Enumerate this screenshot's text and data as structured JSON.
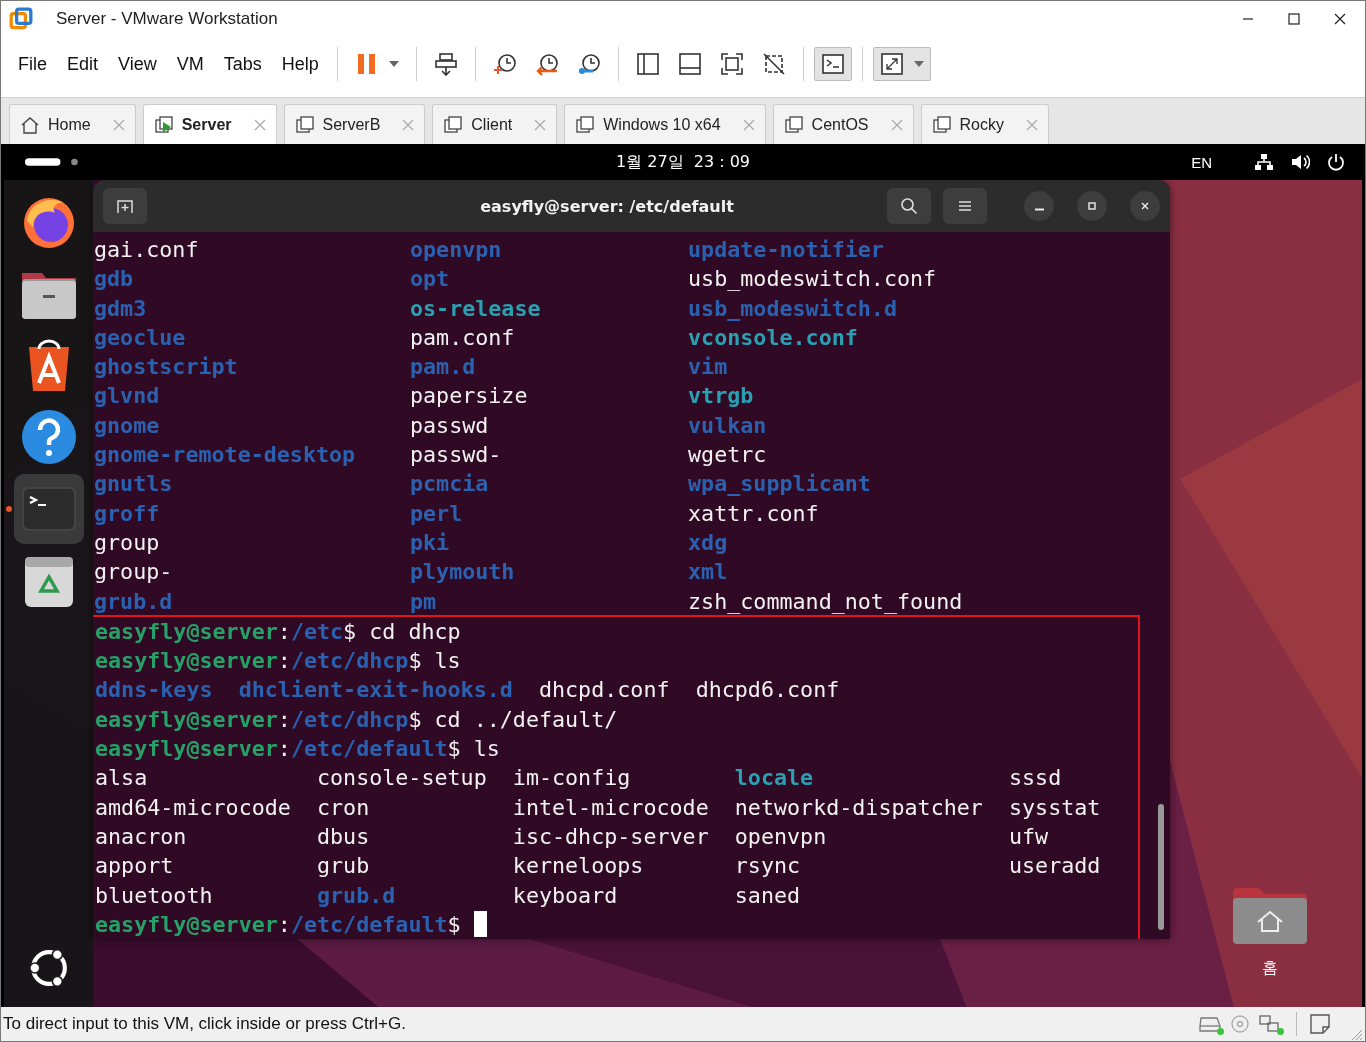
{
  "window": {
    "title": "Server - VMware Workstation"
  },
  "menu": [
    "File",
    "Edit",
    "View",
    "VM",
    "Tabs",
    "Help"
  ],
  "toolbar": [
    [
      {
        "kind": "pause",
        "pressed": false,
        "has_menu": true
      }
    ],
    [
      {
        "kind": "send-keys",
        "pressed": false,
        "has_menu": false
      }
    ],
    [
      {
        "kind": "snapshot-take",
        "pressed": false,
        "has_menu": false
      },
      {
        "kind": "snapshot-revert",
        "pressed": false,
        "has_menu": false
      },
      {
        "kind": "snapshot-manager",
        "pressed": false,
        "has_menu": false
      }
    ],
    [
      {
        "kind": "view-library",
        "pressed": false,
        "has_menu": false
      },
      {
        "kind": "view-thumbnail",
        "pressed": false,
        "has_menu": false
      },
      {
        "kind": "view-fullscreen",
        "pressed": false,
        "has_menu": false
      },
      {
        "kind": "view-unity",
        "pressed": false,
        "has_menu": false
      }
    ],
    [
      {
        "kind": "console",
        "pressed": true,
        "has_menu": false
      }
    ],
    [
      {
        "kind": "stretch",
        "pressed": true,
        "has_menu": true
      }
    ]
  ],
  "tabs": [
    {
      "label": "Home",
      "kind": "home",
      "selected": false
    },
    {
      "label": "Server",
      "kind": "vm",
      "selected": true,
      "running": true
    },
    {
      "label": "ServerB",
      "kind": "vm",
      "selected": false,
      "running": false
    },
    {
      "label": "Client",
      "kind": "vm",
      "selected": false,
      "running": false
    },
    {
      "label": "Windows 10 x64",
      "kind": "vm",
      "selected": false,
      "running": false
    },
    {
      "label": "CentOS",
      "kind": "vm",
      "selected": false,
      "running": false
    },
    {
      "label": "Rocky",
      "kind": "vm",
      "selected": false,
      "running": false
    }
  ],
  "guest": {
    "top_bar": {
      "clock": "1월 27일  23 : 09",
      "input_source": "EN"
    },
    "dock": [
      {
        "kind": "firefox",
        "active": false
      },
      {
        "kind": "files",
        "active": false
      },
      {
        "kind": "app-center",
        "active": false
      },
      {
        "kind": "help",
        "active": false
      },
      {
        "kind": "terminal",
        "active": true
      },
      {
        "kind": "trash",
        "active": false
      }
    ],
    "terminal": {
      "title": "easyfly@server: /etc/default",
      "output_above": [
        {
          "kind": "listing",
          "rows": [
            [
              {
                "text": "gai.conf",
                "kind": "file"
              },
              {
                "text": "openvpn",
                "kind": "dir"
              },
              {
                "text": "update-notifier",
                "kind": "dir"
              }
            ],
            [
              {
                "text": "gdb",
                "kind": "dir"
              },
              {
                "text": "opt",
                "kind": "dir"
              },
              {
                "text": "usb_modeswitch.conf",
                "kind": "file"
              }
            ],
            [
              {
                "text": "gdm3",
                "kind": "dir"
              },
              {
                "text": "os-release",
                "kind": "link"
              },
              {
                "text": "usb_modeswitch.d",
                "kind": "dir"
              }
            ],
            [
              {
                "text": "geoclue",
                "kind": "dir"
              },
              {
                "text": "pam.conf",
                "kind": "file"
              },
              {
                "text": "vconsole.conf",
                "kind": "link"
              }
            ],
            [
              {
                "text": "ghostscript",
                "kind": "dir"
              },
              {
                "text": "pam.d",
                "kind": "dir"
              },
              {
                "text": "vim",
                "kind": "dir"
              }
            ],
            [
              {
                "text": "glvnd",
                "kind": "dir"
              },
              {
                "text": "papersize",
                "kind": "file"
              },
              {
                "text": "vtrgb",
                "kind": "link"
              }
            ],
            [
              {
                "text": "gnome",
                "kind": "dir"
              },
              {
                "text": "passwd",
                "kind": "file"
              },
              {
                "text": "vulkan",
                "kind": "dir"
              }
            ],
            [
              {
                "text": "gnome-remote-desktop",
                "kind": "dir"
              },
              {
                "text": "passwd-",
                "kind": "file"
              },
              {
                "text": "wgetrc",
                "kind": "file"
              }
            ],
            [
              {
                "text": "gnutls",
                "kind": "dir"
              },
              {
                "text": "pcmcia",
                "kind": "dir"
              },
              {
                "text": "wpa_supplicant",
                "kind": "dir"
              }
            ],
            [
              {
                "text": "groff",
                "kind": "dir"
              },
              {
                "text": "perl",
                "kind": "dir"
              },
              {
                "text": "xattr.conf",
                "kind": "file"
              }
            ],
            [
              {
                "text": "group",
                "kind": "file"
              },
              {
                "text": "pki",
                "kind": "dir"
              },
              {
                "text": "xdg",
                "kind": "dir"
              }
            ],
            [
              {
                "text": "group-",
                "kind": "file"
              },
              {
                "text": "plymouth",
                "kind": "dir"
              },
              {
                "text": "xml",
                "kind": "dir"
              }
            ],
            [
              {
                "text": "grub.d",
                "kind": "dir"
              },
              {
                "text": "pm",
                "kind": "dir"
              },
              {
                "text": "zsh_command_not_found",
                "kind": "file"
              }
            ]
          ]
        }
      ],
      "highlighted_output": [
        {
          "kind": "prompt",
          "cursor": false,
          "segments": [
            {
              "text": "easyfly@server",
              "kind": "user"
            },
            {
              "text": ":",
              "kind": "file"
            },
            {
              "text": "/etc",
              "kind": "dir"
            },
            {
              "text": "$ cd dhcp",
              "kind": "file"
            }
          ]
        },
        {
          "kind": "prompt",
          "cursor": false,
          "segments": [
            {
              "text": "easyfly@server",
              "kind": "user"
            },
            {
              "text": ":",
              "kind": "file"
            },
            {
              "text": "/etc/dhcp",
              "kind": "dir"
            },
            {
              "text": "$ ls",
              "kind": "file"
            }
          ]
        },
        {
          "kind": "listing",
          "rows": [
            [
              {
                "text": "ddns-keys",
                "kind": "dir"
              },
              {
                "text": "dhclient-exit-hooks.d",
                "kind": "dir"
              },
              {
                "text": "dhcpd.conf",
                "kind": "file"
              },
              {
                "text": "dhcpd6.conf",
                "kind": "file"
              }
            ]
          ]
        },
        {
          "kind": "prompt",
          "cursor": false,
          "segments": [
            {
              "text": "easyfly@server",
              "kind": "user"
            },
            {
              "text": ":",
              "kind": "file"
            },
            {
              "text": "/etc/dhcp",
              "kind": "dir"
            },
            {
              "text": "$ cd ../default/",
              "kind": "file"
            }
          ]
        },
        {
          "kind": "prompt",
          "cursor": false,
          "segments": [
            {
              "text": "easyfly@server",
              "kind": "user"
            },
            {
              "text": ":",
              "kind": "file"
            },
            {
              "text": "/etc/default",
              "kind": "dir"
            },
            {
              "text": "$ ls",
              "kind": "file"
            }
          ]
        },
        {
          "kind": "listing",
          "rows": [
            [
              {
                "text": "alsa",
                "kind": "file"
              },
              {
                "text": "console-setup",
                "kind": "file"
              },
              {
                "text": "im-config",
                "kind": "file"
              },
              {
                "text": "locale",
                "kind": "link"
              },
              {
                "text": "sssd",
                "kind": "file"
              }
            ],
            [
              {
                "text": "amd64-microcode",
                "kind": "file"
              },
              {
                "text": "cron",
                "kind": "file"
              },
              {
                "text": "intel-microcode",
                "kind": "file"
              },
              {
                "text": "networkd-dispatcher",
                "kind": "file"
              },
              {
                "text": "sysstat",
                "kind": "file"
              }
            ],
            [
              {
                "text": "anacron",
                "kind": "file"
              },
              {
                "text": "dbus",
                "kind": "file"
              },
              {
                "text": "isc-dhcp-server",
                "kind": "file"
              },
              {
                "text": "openvpn",
                "kind": "file"
              },
              {
                "text": "ufw",
                "kind": "file"
              }
            ],
            [
              {
                "text": "apport",
                "kind": "file"
              },
              {
                "text": "grub",
                "kind": "file"
              },
              {
                "text": "kerneloops",
                "kind": "file"
              },
              {
                "text": "rsync",
                "kind": "file"
              },
              {
                "text": "useradd",
                "kind": "file"
              }
            ],
            [
              {
                "text": "bluetooth",
                "kind": "file"
              },
              {
                "text": "grub.d",
                "kind": "dir"
              },
              {
                "text": "keyboard",
                "kind": "file"
              },
              {
                "text": "saned",
                "kind": "file"
              }
            ]
          ]
        },
        {
          "kind": "prompt",
          "cursor": true,
          "segments": [
            {
              "text": "easyfly@server",
              "kind": "user"
            },
            {
              "text": ":",
              "kind": "file"
            },
            {
              "text": "/etc/default",
              "kind": "dir"
            },
            {
              "text": "$ ",
              "kind": "file"
            }
          ]
        }
      ]
    },
    "desktop_icons": [
      {
        "label": "홈"
      }
    ]
  },
  "status_bar": {
    "message": "To direct input to this VM, click inside or press Ctrl+G.",
    "devices": [
      {
        "kind": "disk",
        "connected": true
      },
      {
        "kind": "cd",
        "connected": false
      },
      {
        "kind": "network",
        "connected": true
      }
    ]
  }
}
